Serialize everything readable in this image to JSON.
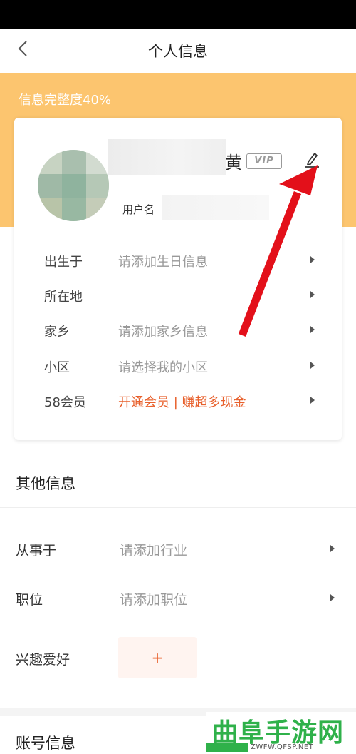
{
  "header": {
    "title": "个人信息"
  },
  "profile": {
    "completeness_text": "信息完整度40%",
    "name_visible_char": "黄",
    "vip_badge": "VIP",
    "username_label": "用户名"
  },
  "basic_info": [
    {
      "label": "出生于",
      "value": "请添加生日信息",
      "accent": false
    },
    {
      "label": "所在地",
      "value": "",
      "accent": false
    },
    {
      "label": "家乡",
      "value": "请添加家乡信息",
      "accent": false
    },
    {
      "label": "小区",
      "value": "请选择我的小区",
      "accent": false
    },
    {
      "label": "58会员",
      "value": "开通会员 | 赚超多现金",
      "accent": true
    }
  ],
  "other_info": {
    "title": "其他信息",
    "rows": [
      {
        "label": "从事于",
        "value": "请添加行业"
      },
      {
        "label": "职位",
        "value": "请添加职位"
      }
    ],
    "hobby_label": "兴趣爱好",
    "hobby_add": "+"
  },
  "account_info": {
    "title": "账号信息"
  },
  "watermark": {
    "title": "曲阜手游网",
    "url": "ZWFW.QFSP.NET"
  },
  "colors": {
    "progress_band": "#fcc56f",
    "accent": "#e8602c",
    "annotation_arrow": "#e3101a"
  },
  "icons": {
    "back": "chevron-left-icon",
    "edit": "pencil-icon",
    "row_arrow": "triangle-right-icon"
  }
}
